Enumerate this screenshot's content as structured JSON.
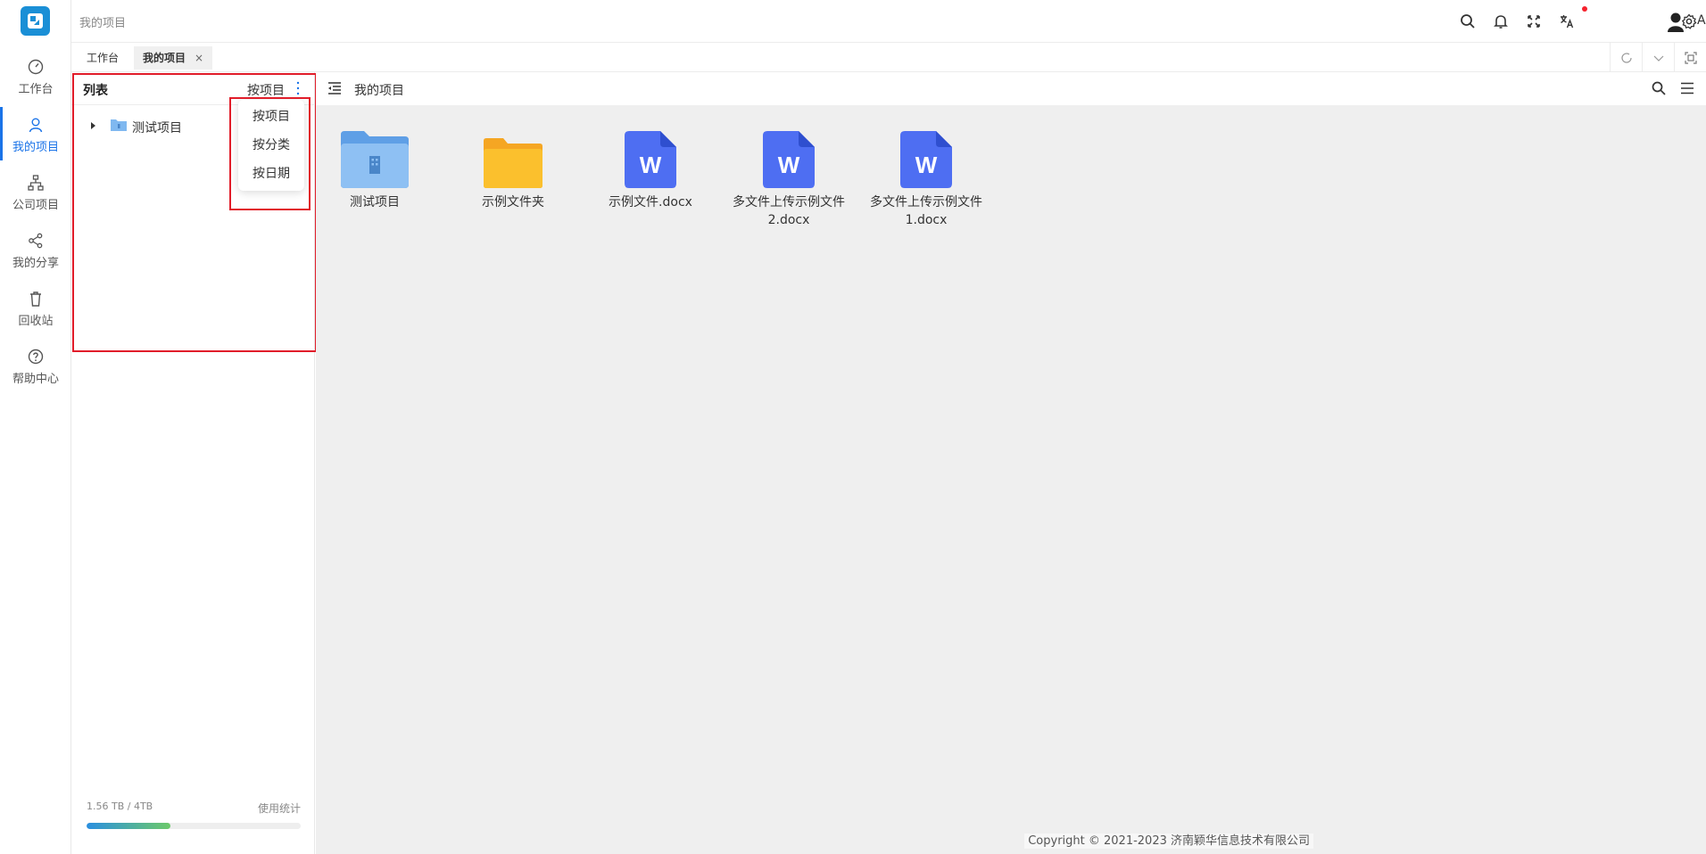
{
  "colors": {
    "accent": "#1a73e8",
    "logo": "#1a8fd6",
    "highlight": "#e11d2a",
    "notify_dot": "#f5222d",
    "folder_blue": "#7fb8f0",
    "folder_yellow": "#fbc02d",
    "word_blue": "#4e6ef2"
  },
  "header": {
    "breadcrumb": "我的项目",
    "user_name": "Admin",
    "icons": [
      "search-icon",
      "bell-icon",
      "fullscreen-icon",
      "translate-icon",
      "user-icon",
      "settings-icon"
    ]
  },
  "sidebar": {
    "items": [
      {
        "label": "工作台",
        "icon": "dashboard-icon"
      },
      {
        "label": "我的项目",
        "icon": "user-icon"
      },
      {
        "label": "公司项目",
        "icon": "org-icon"
      },
      {
        "label": "我的分享",
        "icon": "share-icon"
      },
      {
        "label": "回收站",
        "icon": "trash-icon"
      },
      {
        "label": "帮助中心",
        "icon": "help-icon"
      }
    ]
  },
  "tabs": [
    {
      "label": "工作台"
    },
    {
      "label": "我的项目",
      "close": "×"
    }
  ],
  "left_panel": {
    "title": "列表",
    "sort_label": "按项目",
    "tree": [
      {
        "label": "测试项目"
      }
    ],
    "sort_menu": [
      {
        "label": "按项目"
      },
      {
        "label": "按分类"
      },
      {
        "label": "按日期"
      }
    ],
    "storage": {
      "text": "1.56 TB / 4TB",
      "link": "使用统计",
      "used_fraction": 0.39
    }
  },
  "main": {
    "title": "我的项目",
    "files": [
      {
        "name": "测试项目",
        "type": "project-folder"
      },
      {
        "name": "示例文件夹",
        "type": "folder"
      },
      {
        "name": "示例文件.docx",
        "type": "word"
      },
      {
        "name_line1": "多文件上传示例文件",
        "name_line2": "2.docx",
        "type": "word"
      },
      {
        "name_line1": "多文件上传示例文件",
        "name_line2": "1.docx",
        "type": "word"
      }
    ],
    "copyright": "Copyright © 2021-2023 济南颖华信息技术有限公司"
  }
}
